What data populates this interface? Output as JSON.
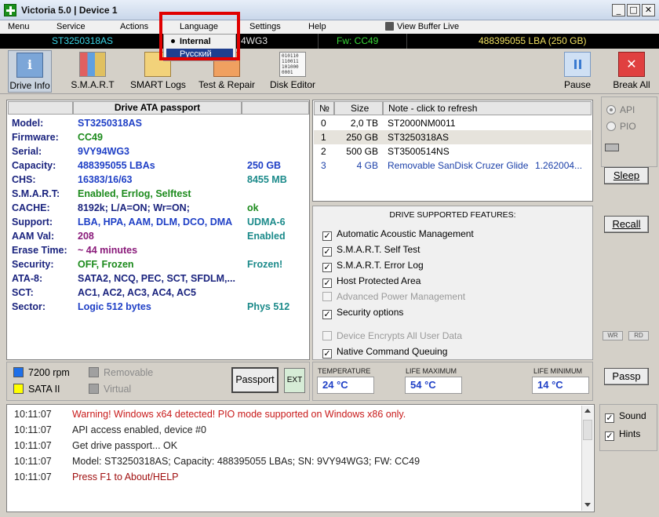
{
  "window": {
    "title": "Victoria 5.0 | Device 1",
    "min": "_",
    "max": "□",
    "close": "✕"
  },
  "menu": [
    "Menu",
    "Service",
    "Actions",
    "Language",
    "Settings",
    "Help"
  ],
  "menu_extra": "View Buffer Live",
  "language_menu": {
    "items": [
      "Internal",
      "Русский"
    ],
    "selected": "Internal"
  },
  "statusbar": {
    "model": "ST3250318AS",
    "serial_frag": "4WG3",
    "firmware": "Fw: CC49",
    "lba": "488395055 LBA (250 GB)"
  },
  "toolbar": {
    "buttons": [
      "Drive Info",
      "S.M.A.R.T",
      "SMART Logs",
      "Test & Repair",
      "Disk Editor"
    ],
    "pause": "Pause",
    "break_all": "Break All",
    "disk_editor_icon_text": "010110\n110011\n101000\n0001"
  },
  "passport": {
    "header": "Drive ATA passport",
    "rows": [
      {
        "label": "Model:",
        "value": "ST3250318AS",
        "extra": ""
      },
      {
        "label": "Firmware:",
        "value": "CC49",
        "extra": ""
      },
      {
        "label": "Serial:",
        "value": "9VY94WG3",
        "extra": ""
      },
      {
        "label": "Capacity:",
        "value": "488395055 LBAs",
        "extra": "250 GB"
      },
      {
        "label": "CHS:",
        "value": "16383/16/63",
        "extra": "8455 MB"
      },
      {
        "label": "S.M.A.R.T:",
        "value": "Enabled, Errlog, Selftest",
        "extra": ""
      },
      {
        "label": "CACHE:",
        "value": "8192k; L/A=ON; Wr=ON;",
        "extra": "ok"
      },
      {
        "label": "Support:",
        "value": "LBA, HPA, AAM, DLM, DCO, DMA",
        "extra": "UDMA-6"
      },
      {
        "label": "AAM Val:",
        "value": "208",
        "extra": "Enabled"
      },
      {
        "label": "Erase Time:",
        "value": "~ 44 minutes",
        "extra": ""
      },
      {
        "label": "Security:",
        "value": "OFF, Frozen",
        "extra": "Frozen!"
      },
      {
        "label": "ATA-8:",
        "value": "SATA2, NCQ, PEC, SCT, SFDLM,...",
        "extra": ""
      },
      {
        "label": "SCT:",
        "value": "AC1, AC2, AC3, AC4, AC5",
        "extra": ""
      },
      {
        "label": "Sector:",
        "value": "Logic 512 bytes",
        "extra": "Phys 512"
      }
    ]
  },
  "drives": {
    "headers": [
      "№",
      "Size",
      "Note - click to refresh"
    ],
    "rows": [
      {
        "n": "0",
        "size": "2,0 TB",
        "note": "ST2000NM0011",
        "extra": ""
      },
      {
        "n": "1",
        "size": "250 GB",
        "note": "ST3250318AS",
        "extra": ""
      },
      {
        "n": "2",
        "size": "500 GB",
        "note": "ST3500514NS",
        "extra": ""
      },
      {
        "n": "3",
        "size": "4 GB",
        "note": "Removable SanDisk Cruzer Glide",
        "extra": "1.262004..."
      }
    ]
  },
  "features": {
    "title": "DRIVE SUPPORTED FEATURES:",
    "items": [
      {
        "label": "Automatic Acoustic Management",
        "checked": true,
        "enabled": true
      },
      {
        "label": "S.M.A.R.T. Self Test",
        "checked": true,
        "enabled": true
      },
      {
        "label": "S.M.A.R.T. Error Log",
        "checked": true,
        "enabled": true
      },
      {
        "label": "Host Protected Area",
        "checked": true,
        "enabled": true
      },
      {
        "label": "Advanced Power Management",
        "checked": false,
        "enabled": false
      },
      {
        "label": "Security options",
        "checked": true,
        "enabled": true
      },
      {
        "label": "Device Encrypts All User Data",
        "checked": false,
        "enabled": false
      },
      {
        "label": "Native Command Queuing",
        "checked": true,
        "enabled": true
      }
    ]
  },
  "right_panel": {
    "api": "API",
    "pio": "PIO",
    "sleep": "Sleep",
    "recall": "Recall",
    "wr": "WR",
    "rd": "RD",
    "passp": "Passp",
    "sound": "Sound",
    "hints": "Hints"
  },
  "legend": {
    "rpm": "7200 rpm",
    "sata": "SATA II",
    "removable": "Removable",
    "virtual": "Virtual",
    "passport_btn": "Passport",
    "ext_btn": "EXT",
    "colors": {
      "rpm": "#1e6fe8",
      "sata": "#ffff00",
      "removable": "#a0a0a0",
      "virtual": "#a0a0a0"
    }
  },
  "temps": {
    "temperature_label": "TEMPERATURE",
    "temperature": "24 °C",
    "life_max_label": "LIFE MAXIMUM",
    "life_max": "54 °C",
    "life_min_label": "LIFE MINIMUM",
    "life_min": "14 °C"
  },
  "log": [
    {
      "time": "10:11:07",
      "text": "Warning! Windows x64 detected! PIO mode supported on Windows x86 only.",
      "color": "#c81a1a"
    },
    {
      "time": "10:11:07",
      "text": "API access enabled, device #0",
      "color": "#222222"
    },
    {
      "time": "10:11:07",
      "text": "Get drive passport... OK",
      "color": "#222222"
    },
    {
      "time": "10:11:07",
      "text": "Model: ST3250318AS; Capacity: 488395055 LBAs; SN: 9VY94WG3; FW: CC49",
      "color": "#222222"
    },
    {
      "time": "10:11:07",
      "text": "Press F1 to About/HELP",
      "color": "#a01010"
    }
  ],
  "colors": {
    "statusbar_bg": "#000000",
    "model_cyan": "#3ad6e8",
    "fw_green": "#38d838",
    "lba_yellow": "#f0e060",
    "highlight_red": "#e00000",
    "menu_sel": "#1f3f8f"
  }
}
